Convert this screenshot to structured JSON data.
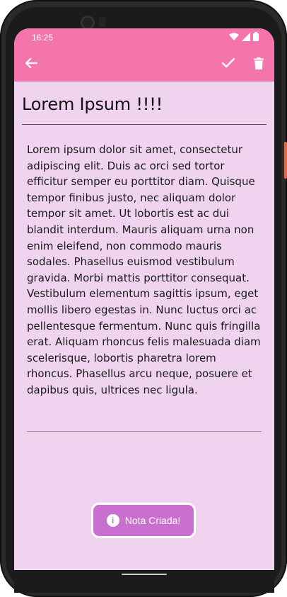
{
  "status_bar": {
    "time": "16:25"
  },
  "app_bar": {
    "back_icon": "arrow-back-icon",
    "confirm_icon": "check-icon",
    "delete_icon": "trash-icon",
    "color": "#f375ac"
  },
  "note": {
    "title": "Lorem Ipsum !!!!",
    "body": "Lorem ipsum dolor sit amet, consectetur adipiscing elit. Duis ac orci sed tortor efficitur semper eu porttitor diam. Quisque tempor finibus justo, nec aliquam dolor tempor sit amet. Ut lobortis est ac dui blandit interdum. Mauris aliquam urna non enim eleifend, non commodo mauris sodales. Phasellus euismod vestibulum gravida. Morbi mattis porttitor consequat. Vestibulum elementum sagittis ipsum, eget mollis libero egestas in. Nunc luctus orci ac pellentesque fermentum. Nunc quis fringilla erat. Aliquam rhoncus felis malesuada diam scelerisque, lobortis pharetra lorem rhoncus. Phasellus arcu neque, posuere et dapibus quis, ultrices nec ligula."
  },
  "toast": {
    "icon": "info-icon",
    "label": "Nota Criada!"
  },
  "colors": {
    "background": "#efd3ef",
    "toast": "#c96fcf"
  }
}
